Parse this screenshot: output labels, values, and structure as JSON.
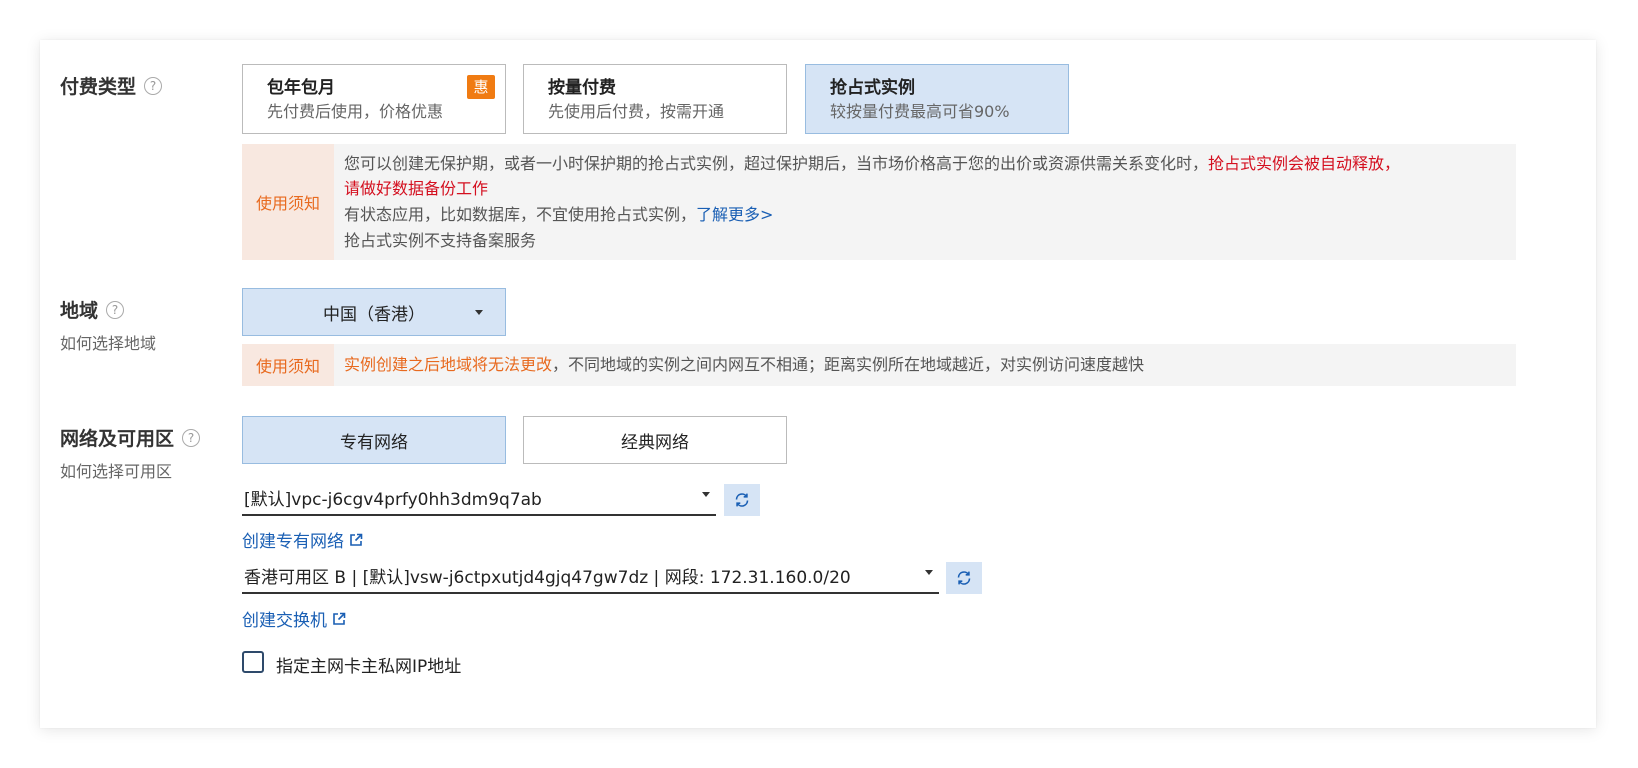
{
  "billing": {
    "title": "付费类型",
    "help_glyph": "?",
    "options": [
      {
        "title": "包年包月",
        "desc": "先付费后使用，价格优惠",
        "badge": "惠",
        "selected": false
      },
      {
        "title": "按量付费",
        "desc": "先使用后付费，按需开通",
        "selected": false
      },
      {
        "title": "抢占式实例",
        "desc": "较按量付费最高可省90%",
        "selected": true
      }
    ],
    "notice": {
      "tag": "使用须知",
      "line1_a": "您可以创建无保护期，或者一小时保护期的抢占式实例，超过保护期后，当市场价格高于您的出价或资源供需关系变化时，",
      "line1_b": "抢占式实例会被自动释放，",
      "line2": "请做好数据备份工作",
      "line3_a": "有状态应用，比如数据库，不宜使用抢占式实例，",
      "line3_link": "了解更多>",
      "line4": "抢占式实例不支持备案服务"
    }
  },
  "region": {
    "title": "地域",
    "help_glyph": "?",
    "subtitle": "如何选择地域",
    "selected": "中国（香港）",
    "notice": {
      "tag": "使用须知",
      "highlight": "实例创建之后地域将无法更改",
      "rest": "，不同地域的实例之间内网互不相通；距离实例所在地域越近，对实例访问速度越快"
    }
  },
  "network": {
    "title": "网络及可用区",
    "help_glyph": "?",
    "subtitle": "如何选择可用区",
    "tabs": [
      {
        "label": "专有网络",
        "selected": true
      },
      {
        "label": "经典网络",
        "selected": false
      }
    ],
    "vpc_value": "[默认]vpc-j6cgv4prfy0hh3dm9q7ab",
    "create_vpc_link": "创建专有网络",
    "vswitch_value": "香港可用区 B | [默认]vsw-j6ctpxutjd4gjq47gw7dz | 网段: 172.31.160.0/20",
    "create_vswitch_link": "创建交换机",
    "checkbox_label": "指定主网卡主私网IP地址",
    "checkbox_checked": false
  },
  "colors": {
    "accent": "#1a5fb4",
    "selected_bg": "#d6e4f5",
    "warning": "#e86a1f",
    "danger": "#d40f1f"
  }
}
